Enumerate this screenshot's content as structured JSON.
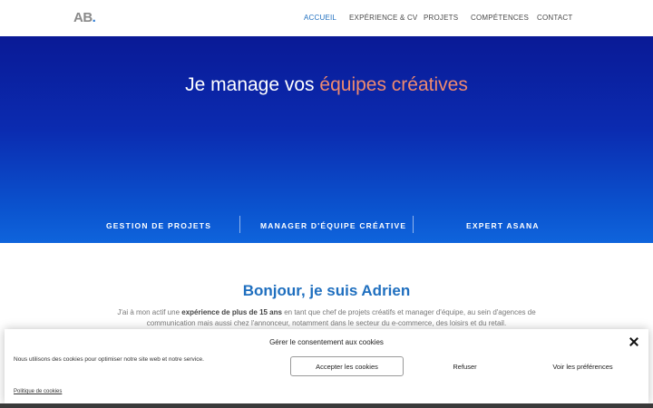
{
  "header": {
    "logo_text": "AB",
    "logo_dot": ".",
    "nav": [
      {
        "label": "ACCUEIL",
        "active": true
      },
      {
        "label": "EXPÉRIENCE & CV",
        "active": false
      },
      {
        "label": "PROJETS",
        "active": false
      },
      {
        "label": "COMPÉTENCES",
        "active": false
      },
      {
        "label": "CONTACT",
        "active": false
      }
    ]
  },
  "hero": {
    "title_prefix": "Je manage vos ",
    "title_accent": "équipes créatives",
    "skills": [
      "GESTION DE PROJETS",
      "MANAGER D'ÉQUIPE CRÉATIVE",
      "EXPERT ASANA"
    ]
  },
  "intro": {
    "title": "Bonjour, je suis Adrien",
    "text_part1": "J'ai à mon actif une ",
    "text_bold": "expérience de plus de 15 ans",
    "text_part2": " en tant que chef de projets créatifs et manager d'équipe, au sein d'agences de communication mais aussi chez l'annonceur, notamment dans le secteur du e-commerce, des loisirs et du retail."
  },
  "cookie": {
    "title": "Gérer le consentement aux cookies",
    "text": "Nous utilisons des cookies pour optimiser notre site web et notre service.",
    "accept_label": "Accepter les cookies",
    "refuse_label": "Refuser",
    "prefs_label": "Voir les préférences",
    "policy_label": "Politique de cookies"
  },
  "colors": {
    "accent": "#1f6fbf",
    "hero_accent": "#ef8a6f",
    "hero_top": "#0a1a96",
    "hero_bottom": "#0f64dc"
  }
}
